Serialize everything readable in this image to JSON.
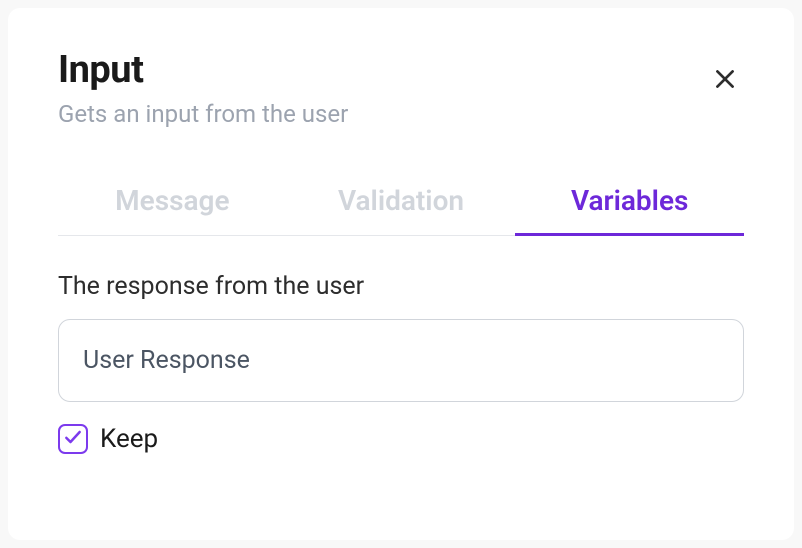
{
  "header": {
    "title": "Input",
    "subtitle": "Gets an input from the user"
  },
  "tabs": {
    "message": "Message",
    "validation": "Validation",
    "variables": "Variables",
    "active": "variables"
  },
  "field": {
    "label": "The response from the user",
    "value": "User Response"
  },
  "keep": {
    "label": "Keep",
    "checked": true
  }
}
